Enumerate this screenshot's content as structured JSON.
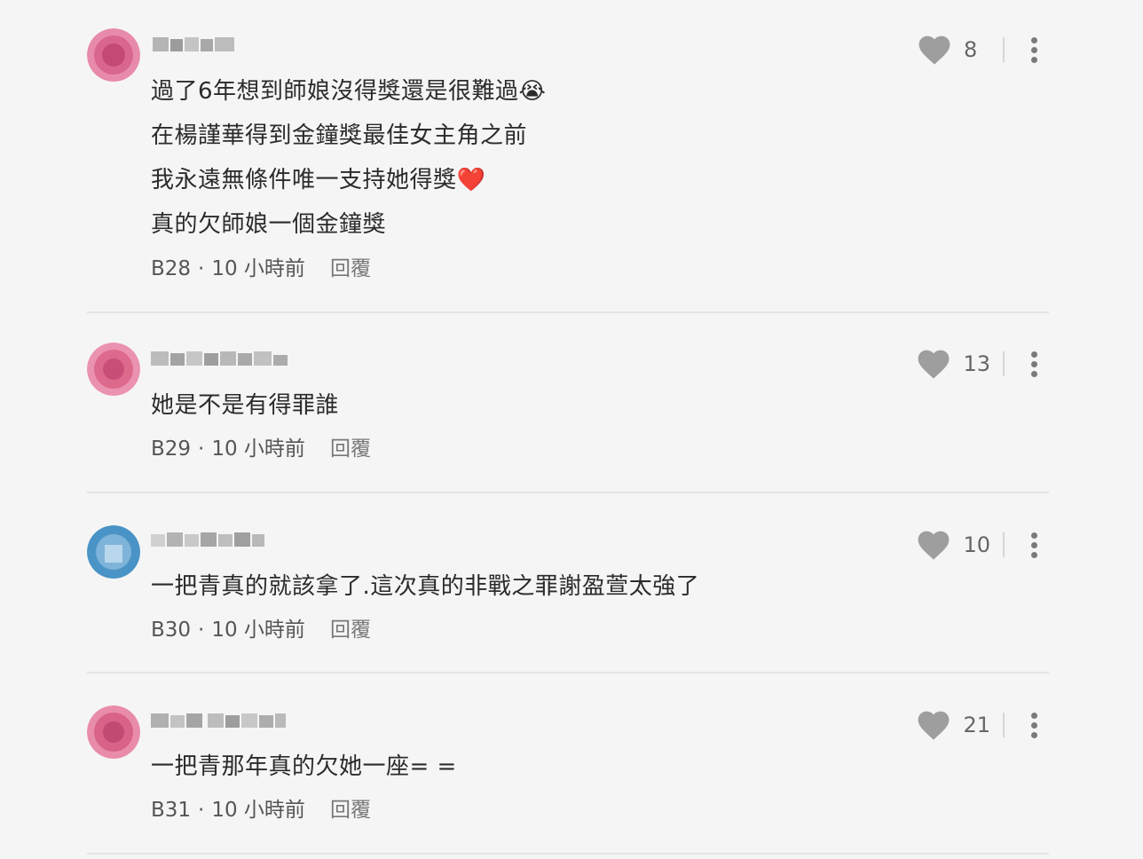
{
  "comments": [
    {
      "lines": [
        "過了6年想到師娘沒得獎還是很難過😭",
        "在楊謹華得到金鐘獎最佳女主角之前",
        "我永遠無條件唯一支持她得獎❤️",
        "真的欠師娘一個金鐘獎"
      ],
      "floor": "B28",
      "time": "10 小時前",
      "reply": "回覆",
      "likes": "8",
      "avatar_color": "#d9668f"
    },
    {
      "lines": [
        "她是不是有得罪誰"
      ],
      "floor": "B29",
      "time": "10 小時前",
      "reply": "回覆",
      "likes": "13",
      "avatar_color": "#dd6a8c"
    },
    {
      "lines": [
        "一把青真的就該拿了.這次真的非戰之罪謝盈萱太強了"
      ],
      "floor": "B30",
      "time": "10 小時前",
      "reply": "回覆",
      "likes": "10",
      "avatar_color": "#4a93c6"
    },
    {
      "lines": [
        "一把青那年真的欠她一座= ="
      ],
      "floor": "B31",
      "time": "10 小時前",
      "reply": "回覆",
      "likes": "21",
      "avatar_color": "#d96289"
    }
  ],
  "meta_separator": "·",
  "colors": {
    "background": "#f5f5f5",
    "icon": "#9e9e9e",
    "divider": "#e4e4e4"
  },
  "icons": {
    "like": "heart-icon",
    "more": "kebab-menu-icon"
  }
}
